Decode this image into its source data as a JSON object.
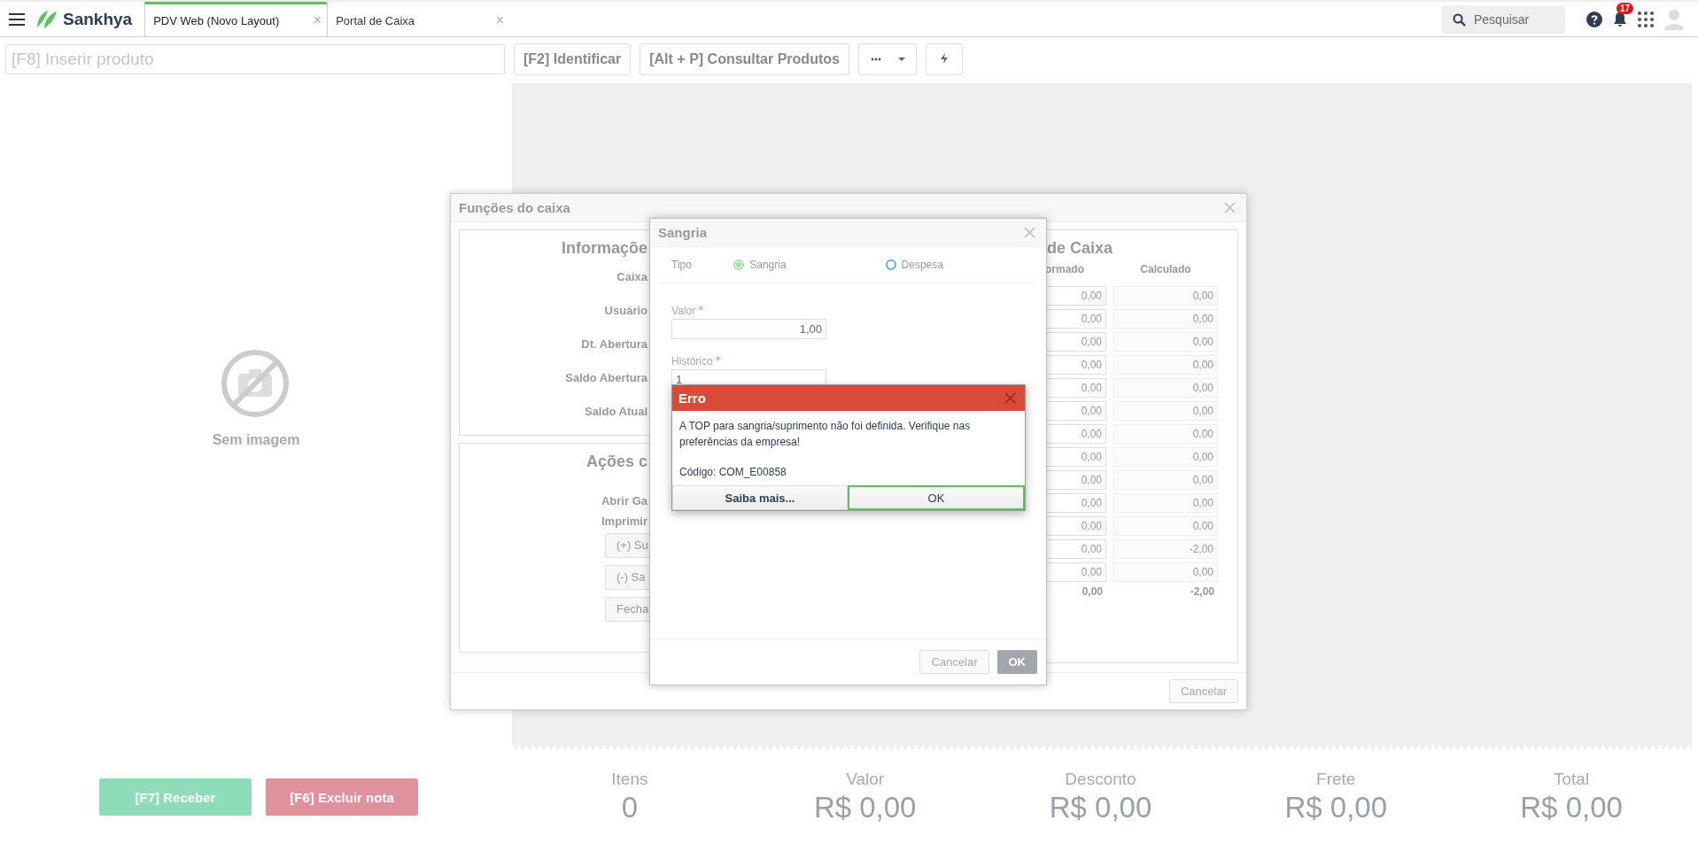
{
  "topbar": {
    "brand": "Sankhya",
    "tabs": [
      {
        "label": "PDV Web (Novo Layout)",
        "selected": true,
        "close": "×"
      },
      {
        "label": "Portal de Caixa",
        "selected": false,
        "close": "×"
      }
    ],
    "search": {
      "placeholder": "Pesquisar"
    },
    "notifications": {
      "count": "17"
    }
  },
  "toolbar": {
    "product_field": {
      "placeholder": "[F8] Inserir produto"
    },
    "buttons": [
      {
        "label": "[F2] Identificar"
      },
      {
        "label": "[Alt + P] Consultar Produtos"
      }
    ]
  },
  "product_image": {
    "caption": "Sem imagem"
  },
  "actions": [
    {
      "label": "[F7] Receber",
      "kind": "receive"
    },
    {
      "label": "[F6] Excluir nota",
      "kind": "delete"
    }
  ],
  "totals": [
    {
      "label": "Itens",
      "value": "0"
    },
    {
      "label": "Valor",
      "value": "R$ 0,00"
    },
    {
      "label": "Desconto",
      "value": "R$ 0,00"
    },
    {
      "label": "Frete",
      "value": "R$ 0,00"
    },
    {
      "label": "Total",
      "value": "R$ 0,00"
    }
  ],
  "cash_functions_dialog": {
    "title": "Funções do caixa",
    "info_panel": {
      "title": "Informaçõe",
      "fields": [
        "Caixa",
        "Usuário",
        "Dt. Abertura",
        "Saldo Abertura",
        "Saldo Atual"
      ]
    },
    "actions_panel": {
      "title": "Ações c",
      "links": [
        "Abrir Ga",
        "Imprimir"
      ],
      "buttons": [
        "(+) Su",
        "(-) Sa",
        "Fecha"
      ]
    },
    "balance_panel": {
      "title": "de Caixa",
      "columns": [
        "ormado",
        "Calculado"
      ],
      "rows": [
        {
          "informed": "0,00",
          "calculated": "0,00"
        },
        {
          "informed": "0,00",
          "calculated": "0,00"
        },
        {
          "informed": "0,00",
          "calculated": "0,00"
        },
        {
          "informed": "0,00",
          "calculated": "0,00"
        },
        {
          "informed": "0,00",
          "calculated": "0,00"
        },
        {
          "informed": "0,00",
          "calculated": "0,00"
        },
        {
          "informed": "0,00",
          "calculated": "0,00"
        },
        {
          "informed": "0,00",
          "calculated": "0,00"
        },
        {
          "informed": "0,00",
          "calculated": "0,00"
        },
        {
          "informed": "0,00",
          "calculated": "0,00"
        },
        {
          "informed": "0,00",
          "calculated": "0,00"
        },
        {
          "informed": "0,00",
          "calculated": "-2,00"
        },
        {
          "informed": "0,00",
          "calculated": "0,00"
        }
      ],
      "totals": {
        "informed": "0,00",
        "calculated": "-2,00"
      }
    },
    "cancel_button": "Cancelar"
  },
  "withdrawal_dialog": {
    "title": "Sangria",
    "type_label": "Tipo",
    "options": [
      {
        "label": "Sangria",
        "selected": true
      },
      {
        "label": "Despesa",
        "selected": false
      }
    ],
    "fields": [
      {
        "label": "Valor",
        "required_mark": "*",
        "value": "1,00",
        "kind": "number"
      },
      {
        "label": "Histórico",
        "required_mark": "*",
        "value": "1",
        "kind": "text"
      }
    ],
    "buttons": [
      {
        "label": "Cancelar",
        "kind": "secondary"
      },
      {
        "label": "OK",
        "kind": "primary"
      }
    ]
  },
  "error_dialog": {
    "title": "Erro",
    "message": "A TOP para sangria/suprimento não foi definida. Verifique nas preferências da empresa!",
    "code": "Código: COM_E00858",
    "buttons": [
      {
        "label": "Saiba mais...",
        "selected": false
      },
      {
        "label": "OK",
        "selected": true
      }
    ]
  }
}
